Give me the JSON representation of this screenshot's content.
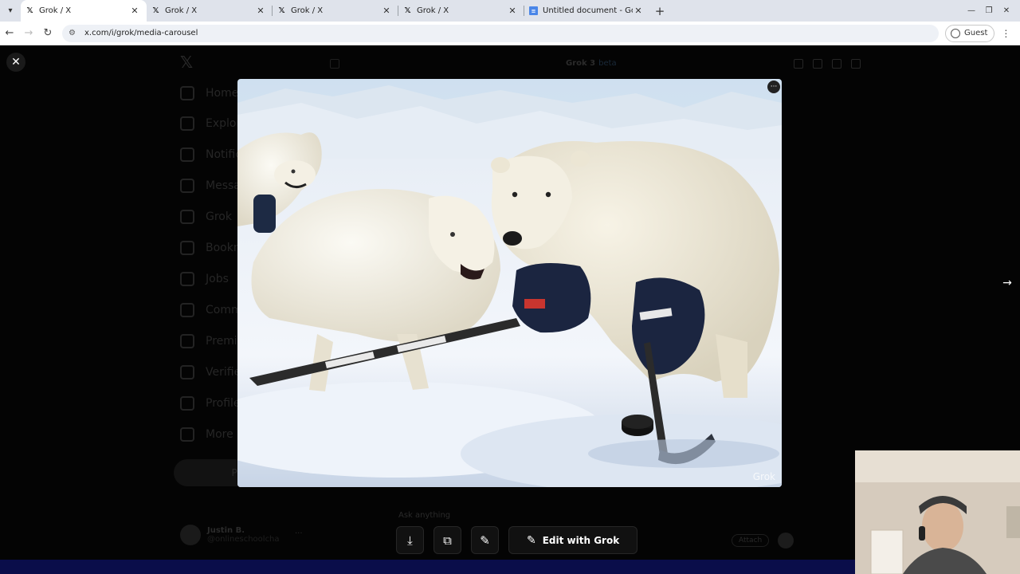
{
  "browser": {
    "tabs": [
      {
        "title": "Grok / X",
        "active": true,
        "favicon": "x-logo-icon"
      },
      {
        "title": "Grok / X",
        "active": false,
        "favicon": "x-logo-icon"
      },
      {
        "title": "Grok / X",
        "active": false,
        "favicon": "x-logo-icon"
      },
      {
        "title": "Grok / X",
        "active": false,
        "favicon": "x-logo-icon"
      },
      {
        "title": "Untitled document - Goog",
        "active": false,
        "favicon": "google-docs-icon"
      }
    ],
    "url": "x.com/i/grok/media-carousel",
    "profile_label": "Guest"
  },
  "sidebar": {
    "items": [
      {
        "label": "Home"
      },
      {
        "label": "Explore"
      },
      {
        "label": "Notifications"
      },
      {
        "label": "Messages"
      },
      {
        "label": "Grok"
      },
      {
        "label": "Bookmarks"
      },
      {
        "label": "Jobs"
      },
      {
        "label": "Communities"
      },
      {
        "label": "Premium"
      },
      {
        "label": "Verified Orgs"
      },
      {
        "label": "Profile"
      },
      {
        "label": "More"
      }
    ],
    "post_label": "Post",
    "account": {
      "name": "Justin B.",
      "handle": "@onlineschoolcha"
    }
  },
  "grok": {
    "model_label": "Grok 3",
    "model_badge": "beta",
    "ask_placeholder": "Ask anything",
    "attach_label": "Attach"
  },
  "modal": {
    "image_alt": "Polar bear and arctic wolves playing ice hockey",
    "watermark": "Grok",
    "edit_label": "Edit with Grok"
  }
}
